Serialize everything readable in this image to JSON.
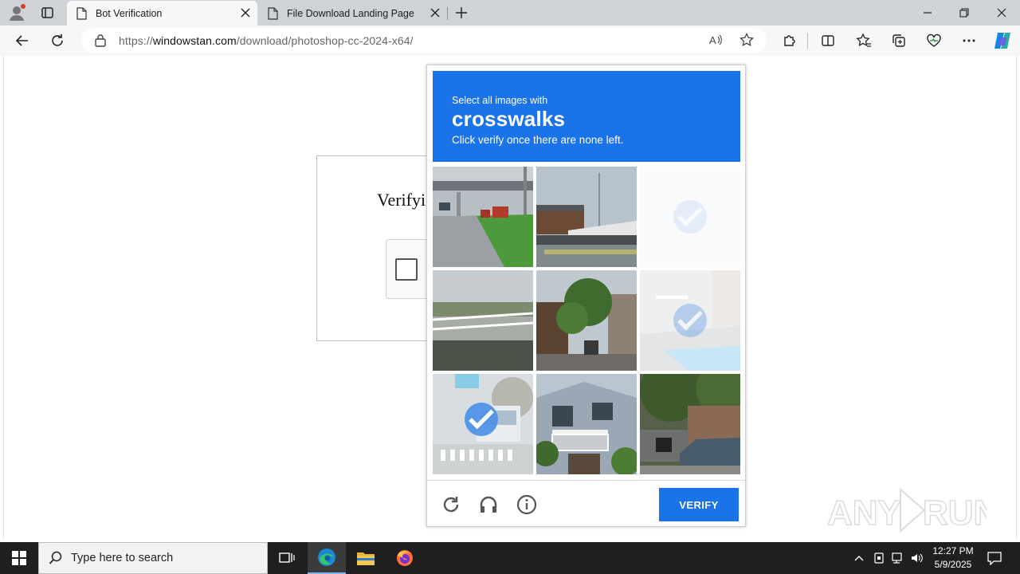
{
  "browser": {
    "tabs": [
      {
        "title": "Bot Verification",
        "active": true
      },
      {
        "title": "File Download Landing Page",
        "active": false
      }
    ],
    "url_prefix": "https://",
    "url_domain": "windowstan.com",
    "url_path": "/download/photoshop-cc-2024-x64/"
  },
  "page": {
    "verify_heading": "Verifyi"
  },
  "captcha": {
    "instruction_line1": "Select all images with",
    "target_word": "crosswalks",
    "instruction_line2": "Click verify once there are none left.",
    "verify_label": "VERIFY",
    "tiles": [
      {
        "name": "road-bridge-tractor",
        "selected": false
      },
      {
        "name": "harbor-boats",
        "selected": false
      },
      {
        "name": "blank-selected",
        "selected": true
      },
      {
        "name": "bridge-railing",
        "selected": false
      },
      {
        "name": "street-houses-tree",
        "selected": false
      },
      {
        "name": "crosswalk-street",
        "selected": true
      },
      {
        "name": "crosswalk-bus",
        "selected": true
      },
      {
        "name": "house-balcony",
        "selected": false
      },
      {
        "name": "car-motorbike-tree",
        "selected": false
      }
    ],
    "accent_color": "#1a73e8"
  },
  "watermark": {
    "text": "ANY RUN"
  },
  "taskbar": {
    "search_placeholder": "Type here to search",
    "time": "12:27 PM",
    "date": "5/9/2025"
  }
}
